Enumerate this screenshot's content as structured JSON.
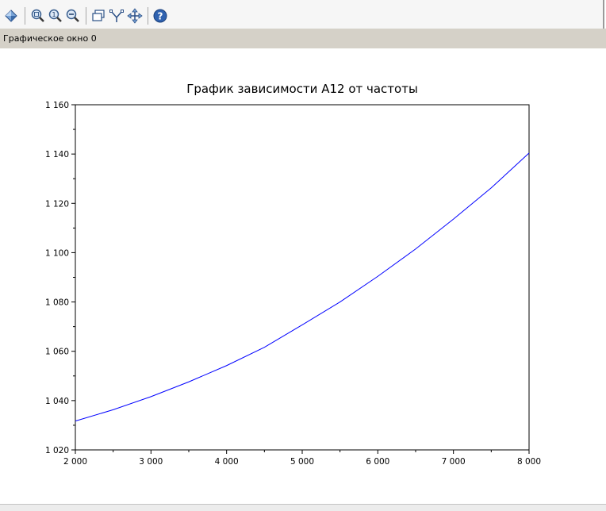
{
  "toolbar": {
    "buttons": [
      {
        "name": "rotate-3d-icon"
      },
      {
        "name": "zoom-in-icon"
      },
      {
        "name": "zoom-original-icon"
      },
      {
        "name": "zoom-area-icon"
      },
      {
        "name": "data-tip-icon"
      },
      {
        "name": "edit-curve-icon"
      },
      {
        "name": "pan-icon"
      },
      {
        "name": "help-icon"
      }
    ]
  },
  "window": {
    "label": "Графическое окно 0"
  },
  "chart_data": {
    "type": "line",
    "title": "График зависимости A12 от частоты",
    "xlabel": "",
    "ylabel": "",
    "xlim": [
      2000,
      8000
    ],
    "ylim": [
      1020,
      1160
    ],
    "x_ticks": [
      2000,
      3000,
      4000,
      5000,
      6000,
      7000,
      8000
    ],
    "x_tick_labels": [
      "2 000",
      "3 000",
      "4 000",
      "5 000",
      "6 000",
      "7 000",
      "8 000"
    ],
    "y_ticks": [
      1020,
      1040,
      1060,
      1080,
      1100,
      1120,
      1140,
      1160
    ],
    "y_tick_labels": [
      "1 020",
      "1 040",
      "1 060",
      "1 080",
      "1 100",
      "1 120",
      "1 140",
      "1 160"
    ],
    "grid": false,
    "series": [
      {
        "color": "#0000ff",
        "x": [
          2000,
          2500,
          3000,
          3500,
          4000,
          4500,
          5000,
          5500,
          6000,
          6500,
          7000,
          7500,
          8000
        ],
        "y": [
          1031.7,
          1036.3,
          1041.6,
          1047.6,
          1054.2,
          1061.6,
          1070.7,
          1080.0,
          1090.4,
          1101.5,
          1113.6,
          1126.3,
          1140.4
        ]
      }
    ]
  }
}
